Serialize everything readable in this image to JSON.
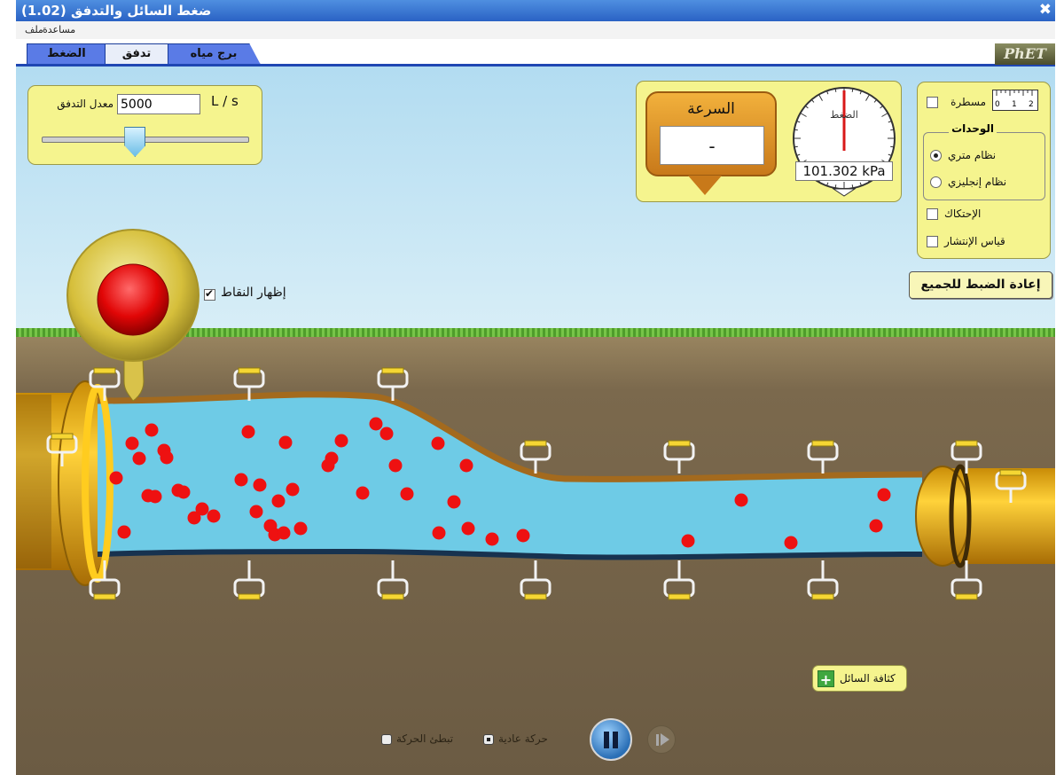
{
  "window": {
    "title": "ضغط السائل والتدفق (1.02)"
  },
  "menu": {
    "file": "ملف",
    "help": "مساعدة"
  },
  "tabs": [
    {
      "label": "الضغط",
      "active": false
    },
    {
      "label": "تدفق",
      "active": true
    },
    {
      "label": "برج مياه",
      "active": false
    }
  ],
  "logo": "PhET",
  "flow": {
    "label": "معدل التدفق",
    "value": "5000",
    "units": "L / s",
    "slider_fraction": 0.45
  },
  "speed": {
    "title": "السرعة",
    "value": "-"
  },
  "pressure": {
    "gauge_label": "الضغط",
    "reading": "101.302 kPa"
  },
  "options": {
    "ruler": {
      "label": "مسطرة",
      "checked": false,
      "ticks": [
        "0",
        "1",
        "2"
      ]
    },
    "units_title": "الوحدات",
    "metric": {
      "label": "نظام متري",
      "checked": true
    },
    "english": {
      "label": "نظام إنجليزي",
      "checked": false
    },
    "friction": {
      "label": "الإحتكاك",
      "checked": false
    },
    "flux": {
      "label": "قياس الإنتشار",
      "checked": false
    }
  },
  "reset_label": "إعادة الضبط للجميع",
  "show_dots": {
    "label": "إظهار النقاط",
    "checked": true
  },
  "fluid_density_label": "كثافة السائل",
  "playback": {
    "normal": {
      "label": "حركة عادية",
      "checked": true
    },
    "slow": {
      "label": "تبطئ الحركة",
      "checked": false
    }
  },
  "colors": {
    "water": "#6ecbe6",
    "pipe_wall": "#a36a1e",
    "pipe_metal": "#e2a81b",
    "particle": "#ee1111",
    "panel": "#f5f48e",
    "sky": "#c8e8f5",
    "ground": "#7b694d"
  },
  "particles": [
    [
      149,
      500
    ],
    [
      171,
      485
    ],
    [
      185,
      508
    ],
    [
      157,
      517
    ],
    [
      188,
      516
    ],
    [
      131,
      539
    ],
    [
      167,
      559
    ],
    [
      175,
      560
    ],
    [
      201,
      553
    ],
    [
      207,
      555
    ],
    [
      228,
      574
    ],
    [
      219,
      584
    ],
    [
      241,
      582
    ],
    [
      140,
      600
    ],
    [
      280,
      487
    ],
    [
      322,
      499
    ],
    [
      272,
      541
    ],
    [
      293,
      547
    ],
    [
      330,
      552
    ],
    [
      314,
      565
    ],
    [
      289,
      577
    ],
    [
      305,
      593
    ],
    [
      310,
      603
    ],
    [
      320,
      601
    ],
    [
      339,
      596
    ],
    [
      385,
      497
    ],
    [
      374,
      517
    ],
    [
      370,
      525
    ],
    [
      424,
      478
    ],
    [
      436,
      489
    ],
    [
      446,
      525
    ],
    [
      409,
      556
    ],
    [
      459,
      557
    ],
    [
      494,
      500
    ],
    [
      526,
      525
    ],
    [
      512,
      566
    ],
    [
      528,
      596
    ],
    [
      495,
      601
    ],
    [
      555,
      608
    ],
    [
      590,
      604
    ],
    [
      776,
      610
    ],
    [
      892,
      612
    ],
    [
      836,
      564
    ],
    [
      997,
      558
    ],
    [
      988,
      593
    ]
  ]
}
